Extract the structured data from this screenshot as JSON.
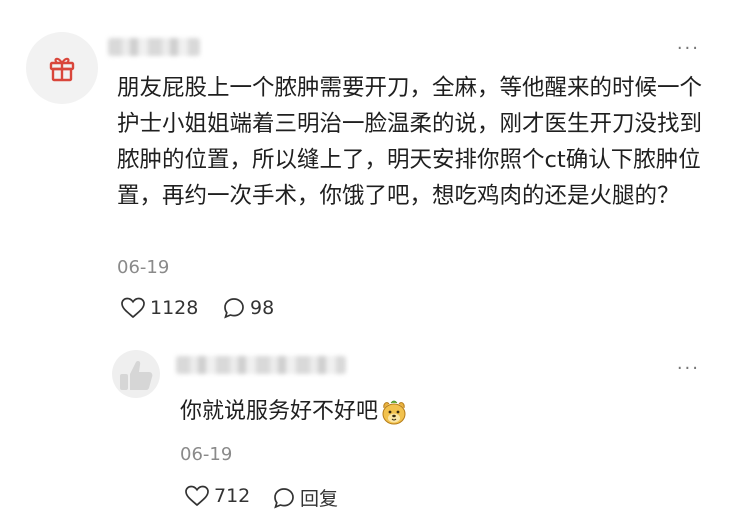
{
  "comment": {
    "avatar_icon": "gift-icon",
    "username": "",
    "text": "朋友屁股上一个脓肿需要开刀，全麻，等他醒来的时候一个护士小姐姐端着三明治一脸温柔的说，刚才医生开刀没找到脓肿的位置，所以缝上了，明天安排你照个ct确认下脓肿位置，再约一次手术，你饿了吧，想吃鸡肉的还是火腿的？",
    "date": "06-19",
    "likes": "1128",
    "comments": "98",
    "more_label": "···"
  },
  "reply": {
    "avatar_icon": "thumbs-up-avatar-icon",
    "username": "",
    "text": "你就说服务好不好吧",
    "emoji": "dog-face-emoji-icon",
    "date": "06-19",
    "likes": "712",
    "reply_label": "回复",
    "more_label": "···"
  },
  "colors": {
    "gift_red": "#d9463b",
    "text": "#1f1f1f",
    "muted": "#8a8a8a"
  }
}
